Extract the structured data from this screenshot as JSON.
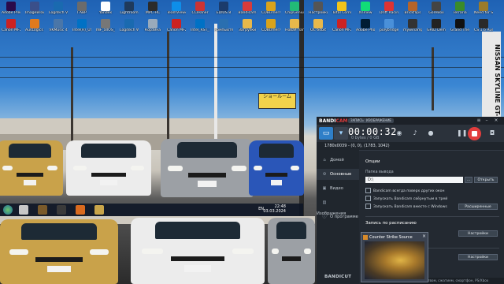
{
  "desktop": {
    "icons": [
      {
        "label": "Adobe Premiere Pro",
        "icon": "premiere-icon",
        "color": "#2a0a4a"
      },
      {
        "label": "ImageBrow… SS",
        "icon": "image-browser-icon",
        "color": "#3a4f8a"
      },
      {
        "label": "Logitech Vid HD",
        "icon": "logitech-vid-icon",
        "color": "#1a6ab0"
      },
      {
        "label": "ГАВР",
        "icon": "file-icon",
        "color": "#6b6b6b"
      },
      {
        "label": "Yandex",
        "icon": "yandex-icon",
        "color": "#ffffff"
      },
      {
        "label": "Lightroom",
        "icon": "lightroom-icon",
        "color": "#1f3a5c"
      },
      {
        "label": "MPC-HC",
        "icon": "mpc-icon",
        "color": "#2b2b2b"
      },
      {
        "label": "TeamViewer 15",
        "icon": "teamviewer-icon",
        "color": "#0e8ee9"
      },
      {
        "label": "CCleaner",
        "icon": "ccleaner-icon",
        "color": "#c33"
      },
      {
        "label": "EDIUS 8",
        "icon": "edius-icon",
        "color": "#1b3b6b"
      },
      {
        "label": "Bandicam",
        "icon": "bandicam-icon",
        "color": "#d83b3b"
      },
      {
        "label": "CDBurnerXP",
        "icon": "cdburner-icon",
        "color": "#d9a31c"
      },
      {
        "label": "ChipGenius",
        "icon": "chipgenius-icon",
        "color": "#2b7"
      },
      {
        "label": "Настройки",
        "icon": "settings-icon",
        "color": "#555"
      },
      {
        "label": "Total Commander",
        "icon": "total-commander-icon",
        "color": "#f0c419"
      },
      {
        "label": "XnView",
        "icon": "xnview-icon",
        "color": "#1d7"
      },
      {
        "label": "Drift Racing Online",
        "icon": "drift-racing-icon",
        "color": "#d33"
      },
      {
        "label": "Brickflips",
        "icon": "brickflips-icon",
        "color": "#b5642a"
      },
      {
        "label": "GoreBox",
        "icon": "gorebox-icon",
        "color": "#444"
      },
      {
        "label": "Terraria",
        "icon": "terraria-icon",
        "color": "#3a8b2a"
      },
      {
        "label": "Need for Speed Most Wanted",
        "icon": "nfs-icon",
        "color": "#9a7b2a"
      }
    ],
    "icons_row2": [
      {
        "label": "Canon MF260 ser…",
        "icon": "canon-icon",
        "color": "#c22"
      },
      {
        "label": "AusLogics BoostSpeed",
        "icon": "auslogics-icon",
        "color": "#e07a1e"
      },
      {
        "label": "VKMusic 4",
        "icon": "vkmusic-icon",
        "color": "#4a76a8"
      },
      {
        "label": "Intel(R)_US…",
        "icon": "intel-icon",
        "color": "#0071c5"
      },
      {
        "label": "INF_allOS_8…",
        "icon": "inf-icon",
        "color": "#777"
      },
      {
        "label": "Logitech Webca…",
        "icon": "logitech-webcam-icon",
        "color": "#1a6ab0"
      },
      {
        "label": "Корзина",
        "icon": "recycle-bin-icon",
        "color": "#9ab"
      },
      {
        "label": "Canon MF260 ser",
        "icon": "canon-icon",
        "color": "#c22"
      },
      {
        "label": "Intel_RST_II…",
        "icon": "intel-icon",
        "color": "#0071c5"
      },
      {
        "label": "Компьютер",
        "icon": "computer-icon",
        "color": "#2a6fb0"
      },
      {
        "label": "Загрузки",
        "icon": "downloads-folder-icon",
        "color": "#e8b84a"
      },
      {
        "label": "CDBurnerXP",
        "icon": "cdburner-icon",
        "color": "#d9a31c"
      },
      {
        "label": "Новая папка",
        "icon": "folder-icon",
        "color": "#e8b84a"
      },
      {
        "label": "ОС 64bit",
        "icon": "folder-icon",
        "color": "#e8b84a"
      },
      {
        "label": "Canon MF260 Ser…",
        "icon": "canon-icon",
        "color": "#c22"
      },
      {
        "label": "Adobe Photoshop",
        "icon": "photoshop-icon",
        "color": "#001d34"
      },
      {
        "label": "polybridge",
        "icon": "polybridge-icon",
        "color": "#4a90d9"
      },
      {
        "label": "mywinamp Pro",
        "icon": "winamp-icon",
        "color": "#333"
      },
      {
        "label": "GRID Demo",
        "icon": "grid-demo-icon",
        "color": "#222"
      },
      {
        "label": "Grand Theft Auto - San…",
        "icon": "gta-icon",
        "color": "#111"
      },
      {
        "label": "CS 1.6 Russian",
        "icon": "cs16-icon",
        "color": "#2a2a2a"
      }
    ]
  },
  "scene": {
    "sign_text": "ショールーム",
    "side_banner": "NISSAN SKYLINE GT-R"
  },
  "inset_taskbar": {
    "lang": "EN",
    "time": "22:48",
    "date": "03.03.2024",
    "buttons": [
      "start-orb-icon",
      "cs-icon",
      "game-icon",
      "nfs-icon",
      "hl-icon",
      "cs-source-icon"
    ]
  },
  "bandicam": {
    "logo_prefix": "BANDI",
    "logo_suffix": "CAM",
    "pills": [
      "ЗАПИСЬ",
      "ИЗОБРАЖЕНИЕ"
    ],
    "timer": "00:00:32",
    "size": "0 bytes / 0 GB",
    "target": "1780x0039 - (0, 0), (1783, 1042)",
    "sidebar": [
      {
        "label": "Домой",
        "icon": "home-icon"
      },
      {
        "label": "Основные",
        "icon": "gear-icon"
      },
      {
        "label": "Видео",
        "icon": "video-icon"
      },
      {
        "label": "Изображения",
        "icon": "image-icon"
      },
      {
        "label": "О программе",
        "icon": "info-icon"
      }
    ],
    "bandicut_label": "BANDICUT",
    "options_title": "Опции",
    "output_label": "Папка вывода",
    "output_value": "D:\\",
    "open_button": "Открыть",
    "more_button": "…",
    "checkboxes": [
      "Bandicam всегда поверх других окон",
      "Запускать Bandicam свёрнутым в трей",
      "Запускать Bandicam вместе с Windows"
    ],
    "advanced_button": "Расширенные",
    "schedule_title": "Запись по расписанию",
    "settings_button_1": "Настройки",
    "settings_button_2": "Настройки",
    "footer_text": "Записывайте экран с высоким качеством, сжатием, смартфон, PS/Xbox"
  },
  "popup": {
    "title": "Counter Strike Source"
  }
}
